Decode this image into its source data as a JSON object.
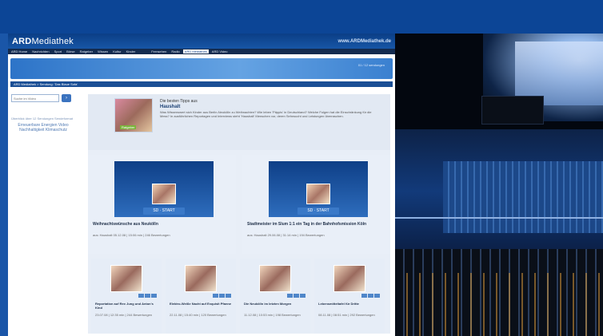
{
  "header": {
    "logo_bold": "ARD",
    "logo_light": "Mediathek",
    "url": "www.ARDMediathek.de"
  },
  "nav": {
    "items": [
      "ARD Home",
      "Nachrichten",
      "Sport",
      "Börse",
      "Ratgeber",
      "Wissen",
      "Kultur",
      "Kinder"
    ],
    "items_right": [
      "Fernsehen",
      "Radio",
      "ARD Mediathek",
      "ARD Video"
    ]
  },
  "hero": {
    "meta": "01 / 12 sendungen"
  },
  "crumb": {
    "text": "ARD Mediathek > Sendung: 'Das Blaue Sofa'"
  },
  "sidebar": {
    "search_placeholder": "Suche im Video",
    "search_button_icon": "arrow-right-icon",
    "small_text": "Überblick über 12 Sendungen Sendeformat",
    "links": "Erneuerbare Energien Video Nachhaltigkeit Klimaschutz"
  },
  "feature": {
    "kicker": "Die besten Tipps aus",
    "title": "Haushalt",
    "tag": "Ratgeber",
    "body": "Was Wissenswert sich Kinder aus Berlin-Neukölln zu Weihnachten? Wie leben 'Päppis' in Deutschland? Welche Folgen hat die Einschränkung für die Mess? In ausführlichen Reportagen und Interviews steht 'Haushalt' Menschen vor, deren Sehnsucht und Leistungen überraschen."
  },
  "big_cards": [
    {
      "play_label": "SD · START",
      "title": "Weihnachtswünsche aus Neukölln",
      "meta": "aus: Haushalt 05.12.08 | 15:06 min | 246 Bewertungen"
    },
    {
      "play_label": "SD · START",
      "title": "Stadtmeister im Slum 1:1 ein Tag in der Bahnhofsmission Köln",
      "meta": "aus: Haushalt 29.06.08 | 31:14 min | 194 Bewertungen"
    }
  ],
  "small_cards": [
    {
      "title": "Reportation auf Rex Jung und Anton's Kind",
      "meta": "23.07.08 | 12:35 min | 244 Bewertungen"
    },
    {
      "title": "Elektro-Weiße Nacht auf Exquisit Pfanne",
      "meta": "22.11.08 | 15:40 min | 120 Bewertungen"
    },
    {
      "title": "Die Neukölln im letzten Morgen",
      "meta": "11.12.08 | 10:53 min | 198 Bewertungen"
    },
    {
      "title": "Lebensmitteltafel für Dritte",
      "meta": "08.11.08 | 08:51 min | 292 Bewertungen"
    }
  ]
}
